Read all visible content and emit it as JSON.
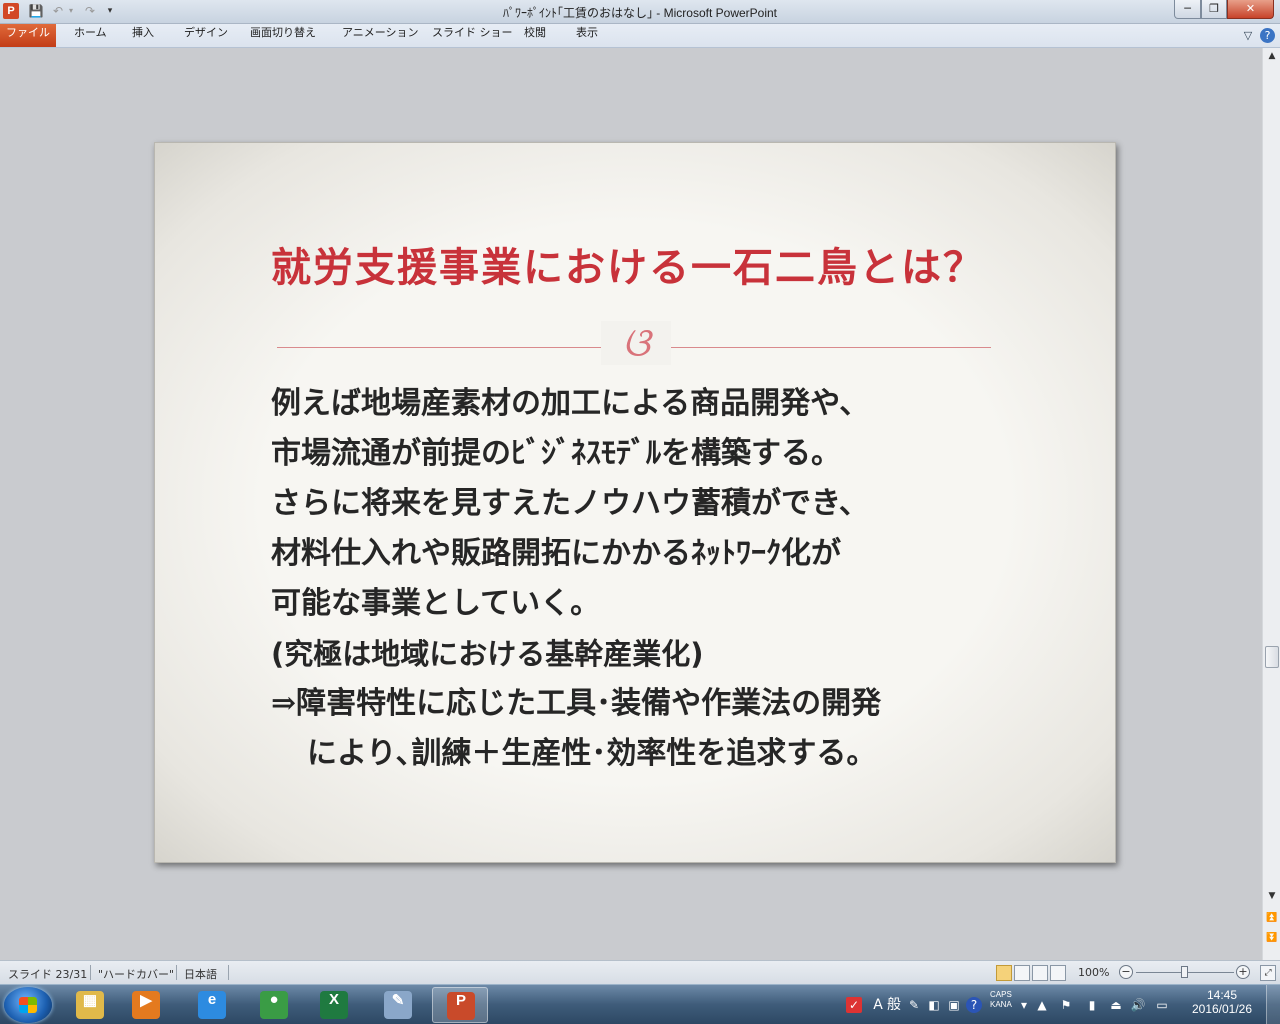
{
  "window": {
    "title": "ﾊﾟﾜｰﾎﾟｲﾝﾄ｢工賃のおはなし｣ - Microsoft PowerPoint",
    "app_icon_letter": "P",
    "minimize_glyph": "─",
    "maximize_glyph": "❐",
    "close_glyph": "✕"
  },
  "quick_access": {
    "save_icon": "💾",
    "undo_icon": "↶",
    "undo_dropdown": "▾",
    "redo_icon": "↷",
    "customize_icon": "▾"
  },
  "ribbon": {
    "tabs": [
      "ファイル",
      "ホーム",
      "挿入",
      "デザイン",
      "画面切り替え",
      "アニメーション",
      "スライド ショー",
      "校閲",
      "表示"
    ],
    "minimize_ribbon_glyph": "▽",
    "help_glyph": "?"
  },
  "slide": {
    "title": "就労支援事業における一石二鳥とは？",
    "ornament": "ଓ",
    "lines": [
      "例えば地場産素材の加工による商品開発や、",
      "市場流通が前提のﾋﾞｼﾞﾈｽﾓﾃﾞﾙを構築する。",
      "さらに将来を見すえたノウハウ蓄積ができ、",
      "材料仕入れや販路開拓にかかるﾈｯﾄﾜｰｸ化が",
      "可能な事業としていく。",
      "(究極は地域における基幹産業化)",
      "⇒障害特性に応じた工具･装備や作業法の開発",
      "により､訓練＋生産性･効率性を追求する。"
    ]
  },
  "scrollbar": {
    "up_glyph": "▲",
    "down_glyph": "▼",
    "prev_slide_glyph": "⏫",
    "next_slide_glyph": "⏬"
  },
  "status": {
    "slide_info": "スライド 23/31",
    "theme": "\"ハードカバー\"",
    "language": "日本語",
    "zoom": "100%",
    "zoom_minus": "−",
    "zoom_plus": "+",
    "fit_glyph": "⤢"
  },
  "taskbar": {
    "apps": [
      {
        "name": "explorer",
        "glyph": "▦",
        "color": "#e0b94a"
      },
      {
        "name": "media-player",
        "glyph": "▶",
        "color": "#e47a1f"
      },
      {
        "name": "internet-explorer",
        "glyph": "e",
        "color": "#2d8be0"
      },
      {
        "name": "chrome",
        "glyph": "●",
        "color": "#3a9c45"
      },
      {
        "name": "excel",
        "glyph": "X",
        "color": "#1f7a40"
      },
      {
        "name": "paint",
        "glyph": "✎",
        "color": "#8aa7c9"
      },
      {
        "name": "powerpoint",
        "glyph": "P",
        "color": "#c94a2a"
      }
    ],
    "ime_mode": "A",
    "ime_general": "般",
    "caps": "CAPS",
    "kana": "KANA",
    "time": "14:45",
    "date": "2016/01/26"
  }
}
